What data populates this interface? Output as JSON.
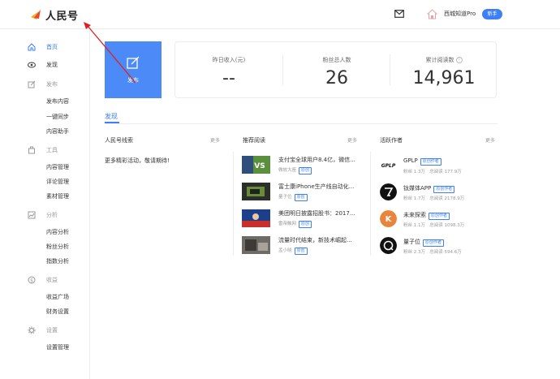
{
  "header": {
    "logo_text": "人民号",
    "username": "西城知道Pro",
    "badge": "新手"
  },
  "sidebar": {
    "home": "首页",
    "discover": "发现",
    "publish": "发布",
    "publish_items": [
      "发布内容",
      "一键同步",
      "内容助手"
    ],
    "tools": "工具",
    "tools_items": [
      "内容管理",
      "评论管理",
      "素材管理"
    ],
    "analysis": "分析",
    "analysis_items": [
      "内容分析",
      "粉丝分析",
      "指数分析"
    ],
    "income": "收益",
    "income_items": [
      "收益广场",
      "财务设置"
    ],
    "settings": "设置",
    "settings_items": [
      "设置管理"
    ]
  },
  "publish_card": {
    "label": "发布"
  },
  "stats": [
    {
      "label": "昨日收入(元)",
      "value": "--"
    },
    {
      "label": "粉丝总人数",
      "value": "26"
    },
    {
      "label": "累计阅读数",
      "value": "14,961"
    }
  ],
  "tab": "发现",
  "clues": {
    "title": "人民号线索",
    "more": "更多",
    "text": "更多精彩活动，敬请期待!"
  },
  "recommended": {
    "title": "推荐阅读",
    "more": "更多",
    "articles": [
      {
        "title": "支付宝全球用户8.4亿，微信...",
        "source": "做放大座",
        "tag": "原创"
      },
      {
        "title": "富士康iPhone生产线自动化...",
        "source": "量子位",
        "tag": "原创"
      },
      {
        "title": "美团明日披露招股书：2017...",
        "source": "雷帝触网",
        "tag": "原创"
      },
      {
        "title": "流量时代结束，新技术崛起...",
        "source": "孟小晓",
        "tag": "原创"
      }
    ]
  },
  "authors": {
    "title": "活跃作者",
    "more": "更多",
    "list": [
      {
        "name": "GPLP",
        "tag": "原创作者",
        "fans": "粉丝 1.3万",
        "reads": "总阅读 177.9万"
      },
      {
        "name": "钛媒体APP",
        "tag": "原创作者",
        "fans": "粉丝 1.7万",
        "reads": "总阅读 2178.9万"
      },
      {
        "name": "未来探索",
        "tag": "原创作者",
        "fans": "粉丝 1.1万",
        "reads": "总阅读 1098.3万"
      },
      {
        "name": "量子位",
        "tag": "原创作者",
        "fans": "粉丝 2.3万",
        "reads": "总阅读 594.6万"
      }
    ]
  },
  "avatar_logos": {
    "gplp": "GPLP",
    "k": "K"
  },
  "colors": {
    "accent": "#3d7ff6",
    "publish_card": "#4b8af7",
    "annotation_arrow": "#e02020"
  }
}
